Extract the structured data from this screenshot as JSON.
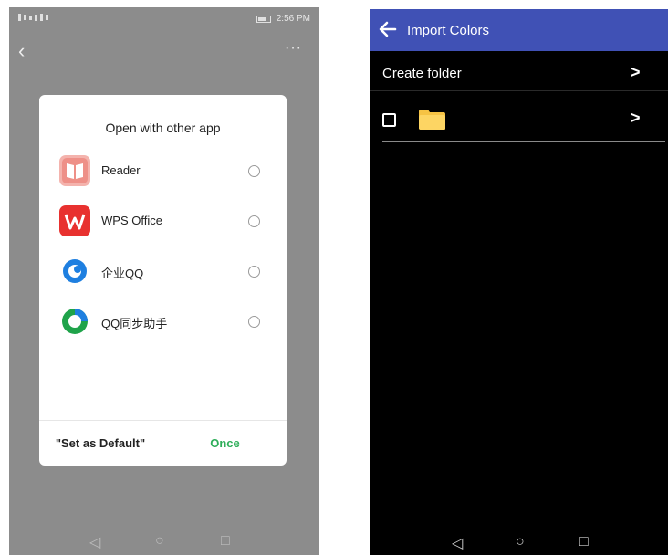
{
  "left_screen": {
    "status_bar": {
      "time": "2:56 PM"
    },
    "top_more": "···",
    "dialog": {
      "title": "Open with other app",
      "apps": [
        {
          "label": "Reader",
          "icon": "reader-icon",
          "color": "#f0a09a"
        },
        {
          "label": "WPS Office",
          "icon": "wps-office-icon",
          "color": "#e8312f"
        },
        {
          "label": "企业QQ",
          "icon": "enterprise-qq-icon",
          "color": "#1e7fe0"
        },
        {
          "label": "QQ同步助手",
          "icon": "qq-sync-assistant-icon",
          "color": "#1fa34a"
        }
      ],
      "set_default_label": "\"Set as Default\"",
      "once_label": "Once"
    },
    "nav": {
      "back": "◁",
      "home": "○",
      "recents": "□"
    }
  },
  "right_screen": {
    "header": {
      "title": "Import Colors",
      "accent": "#4051b5"
    },
    "rows": [
      {
        "label": "Create folder",
        "chevron": ">"
      },
      {
        "label": "",
        "chevron": ">"
      }
    ],
    "nav": {
      "back": "◁",
      "home": "○",
      "recents": "□"
    }
  }
}
